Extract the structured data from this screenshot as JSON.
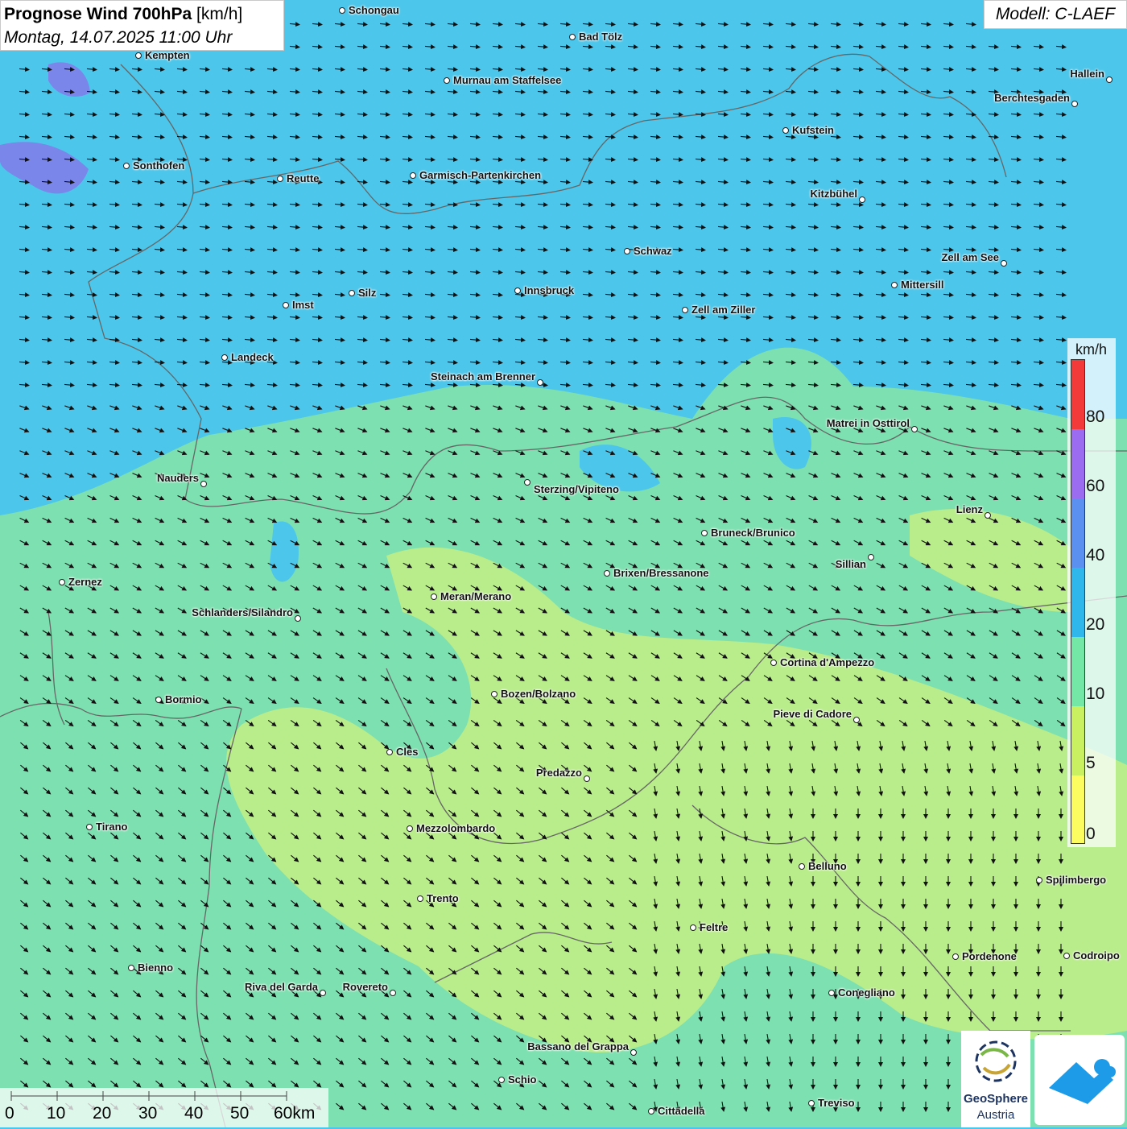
{
  "header": {
    "title_bold": "Prognose Wind 700hPa",
    "title_unit": "[km/h]",
    "datetime": "Montag, 14.07.2025 11:00 Uhr",
    "model": "Modell: C-LAEF"
  },
  "legend": {
    "unit": "km/h",
    "labels": [
      "80",
      "60",
      "40",
      "20",
      "10",
      "5",
      "0"
    ],
    "colors": [
      "#f23a3a",
      "#9b6cf0",
      "#5b8ff0",
      "#2fb6ea",
      "#74e6a6",
      "#c8f060",
      "#fcfc60"
    ]
  },
  "scalebar": {
    "labels": [
      "0",
      "10",
      "20",
      "30",
      "40",
      "50",
      "60km"
    ]
  },
  "logos": {
    "geosphere_line1": "GeoSphere",
    "geosphere_line2": "Austria"
  },
  "cities": [
    {
      "name": "Schongau"
    },
    {
      "name": "Bad Tölz"
    },
    {
      "name": "Kempten"
    },
    {
      "name": "Murnau am Staffelsee"
    },
    {
      "name": "Hallein"
    },
    {
      "name": "Berchtesgaden"
    },
    {
      "name": "Kufstein"
    },
    {
      "name": "Sonthofen"
    },
    {
      "name": "Reutte"
    },
    {
      "name": "Garmisch-Partenkirchen"
    },
    {
      "name": "Kitzbühel"
    },
    {
      "name": "Schwaz"
    },
    {
      "name": "Zell am See"
    },
    {
      "name": "Mittersill"
    },
    {
      "name": "Innsbruck"
    },
    {
      "name": "Silz"
    },
    {
      "name": "Imst"
    },
    {
      "name": "Zell am Ziller"
    },
    {
      "name": "Landeck"
    },
    {
      "name": "Steinach am Brenner"
    },
    {
      "name": "Matrei in Osttirol"
    },
    {
      "name": "Nauders"
    },
    {
      "name": "Sterzing/Vipiteno"
    },
    {
      "name": "Lienz"
    },
    {
      "name": "Bruneck/Brunico"
    },
    {
      "name": "Sillian"
    },
    {
      "name": "Brixen/Bressanone"
    },
    {
      "name": "Zernez"
    },
    {
      "name": "Meran/Merano"
    },
    {
      "name": "Schlanders/Silandro"
    },
    {
      "name": "Cortina d'Ampezzo"
    },
    {
      "name": "Bozen/Bolzano"
    },
    {
      "name": "Bormio"
    },
    {
      "name": "Pieve di Cadore"
    },
    {
      "name": "Cles"
    },
    {
      "name": "Predazzo"
    },
    {
      "name": "Tirano"
    },
    {
      "name": "Mezzolombardo"
    },
    {
      "name": "Belluno"
    },
    {
      "name": "Spilimbergo"
    },
    {
      "name": "Trento"
    },
    {
      "name": "Feltre"
    },
    {
      "name": "Pordenone"
    },
    {
      "name": "Codroipo"
    },
    {
      "name": "Bienno"
    },
    {
      "name": "Riva del Garda"
    },
    {
      "name": "Rovereto"
    },
    {
      "name": "Conegliano"
    },
    {
      "name": "Bassano del Grappa"
    },
    {
      "name": "Schio"
    },
    {
      "name": "Treviso"
    },
    {
      "name": "Cittadella"
    }
  ]
}
